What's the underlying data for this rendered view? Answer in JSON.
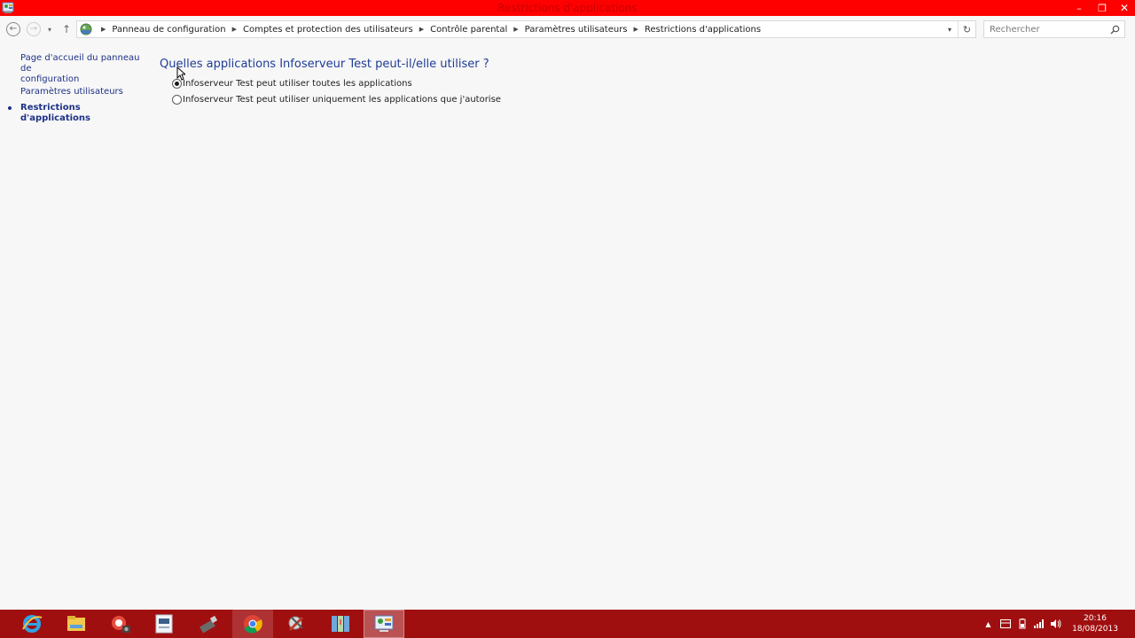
{
  "window": {
    "title": "Restrictions d'applications",
    "minimize": "–",
    "maximize": "❐",
    "close": "✕"
  },
  "nav": {
    "back": "←",
    "forward": "→",
    "recent": "▾",
    "up": "↑"
  },
  "address": {
    "crumbs": [
      "Panneau de configuration",
      "Comptes et protection des utilisateurs",
      "Contrôle parental",
      "Paramètres utilisateurs",
      "Restrictions d'applications"
    ],
    "dropdown": "▾",
    "refresh": "↻"
  },
  "search": {
    "placeholder": "Rechercher"
  },
  "sidebar": {
    "items": [
      {
        "label_line1": "Page d'accueil du panneau de",
        "label_line2": "configuration"
      },
      {
        "label": "Paramètres utilisateurs"
      },
      {
        "label": "Restrictions d'applications",
        "current": true
      }
    ]
  },
  "main": {
    "heading": "Quelles applications Infoserveur Test peut-il/elle utiliser ?",
    "options": [
      {
        "label": "Infoserveur Test peut utiliser toutes les applications",
        "selected": true
      },
      {
        "label": "Infoserveur Test peut utiliser uniquement les applications que j'autorise",
        "selected": false
      }
    ]
  },
  "taskbar": {
    "apps": [
      "internet-explorer-icon",
      "file-explorer-icon",
      "camera-app-icon",
      "scanner-app-icon",
      "usb-tool-icon",
      "chrome-icon",
      "tools-app-icon",
      "map-app-icon",
      "control-panel-icon"
    ],
    "tray": {
      "show_hidden": "▲",
      "time": "20:16",
      "date": "18/08/2013"
    }
  },
  "colors": {
    "titlebar": "#ff0000",
    "taskbar": "#a00f10",
    "link": "#1e3287",
    "heading": "#1e3c96"
  }
}
